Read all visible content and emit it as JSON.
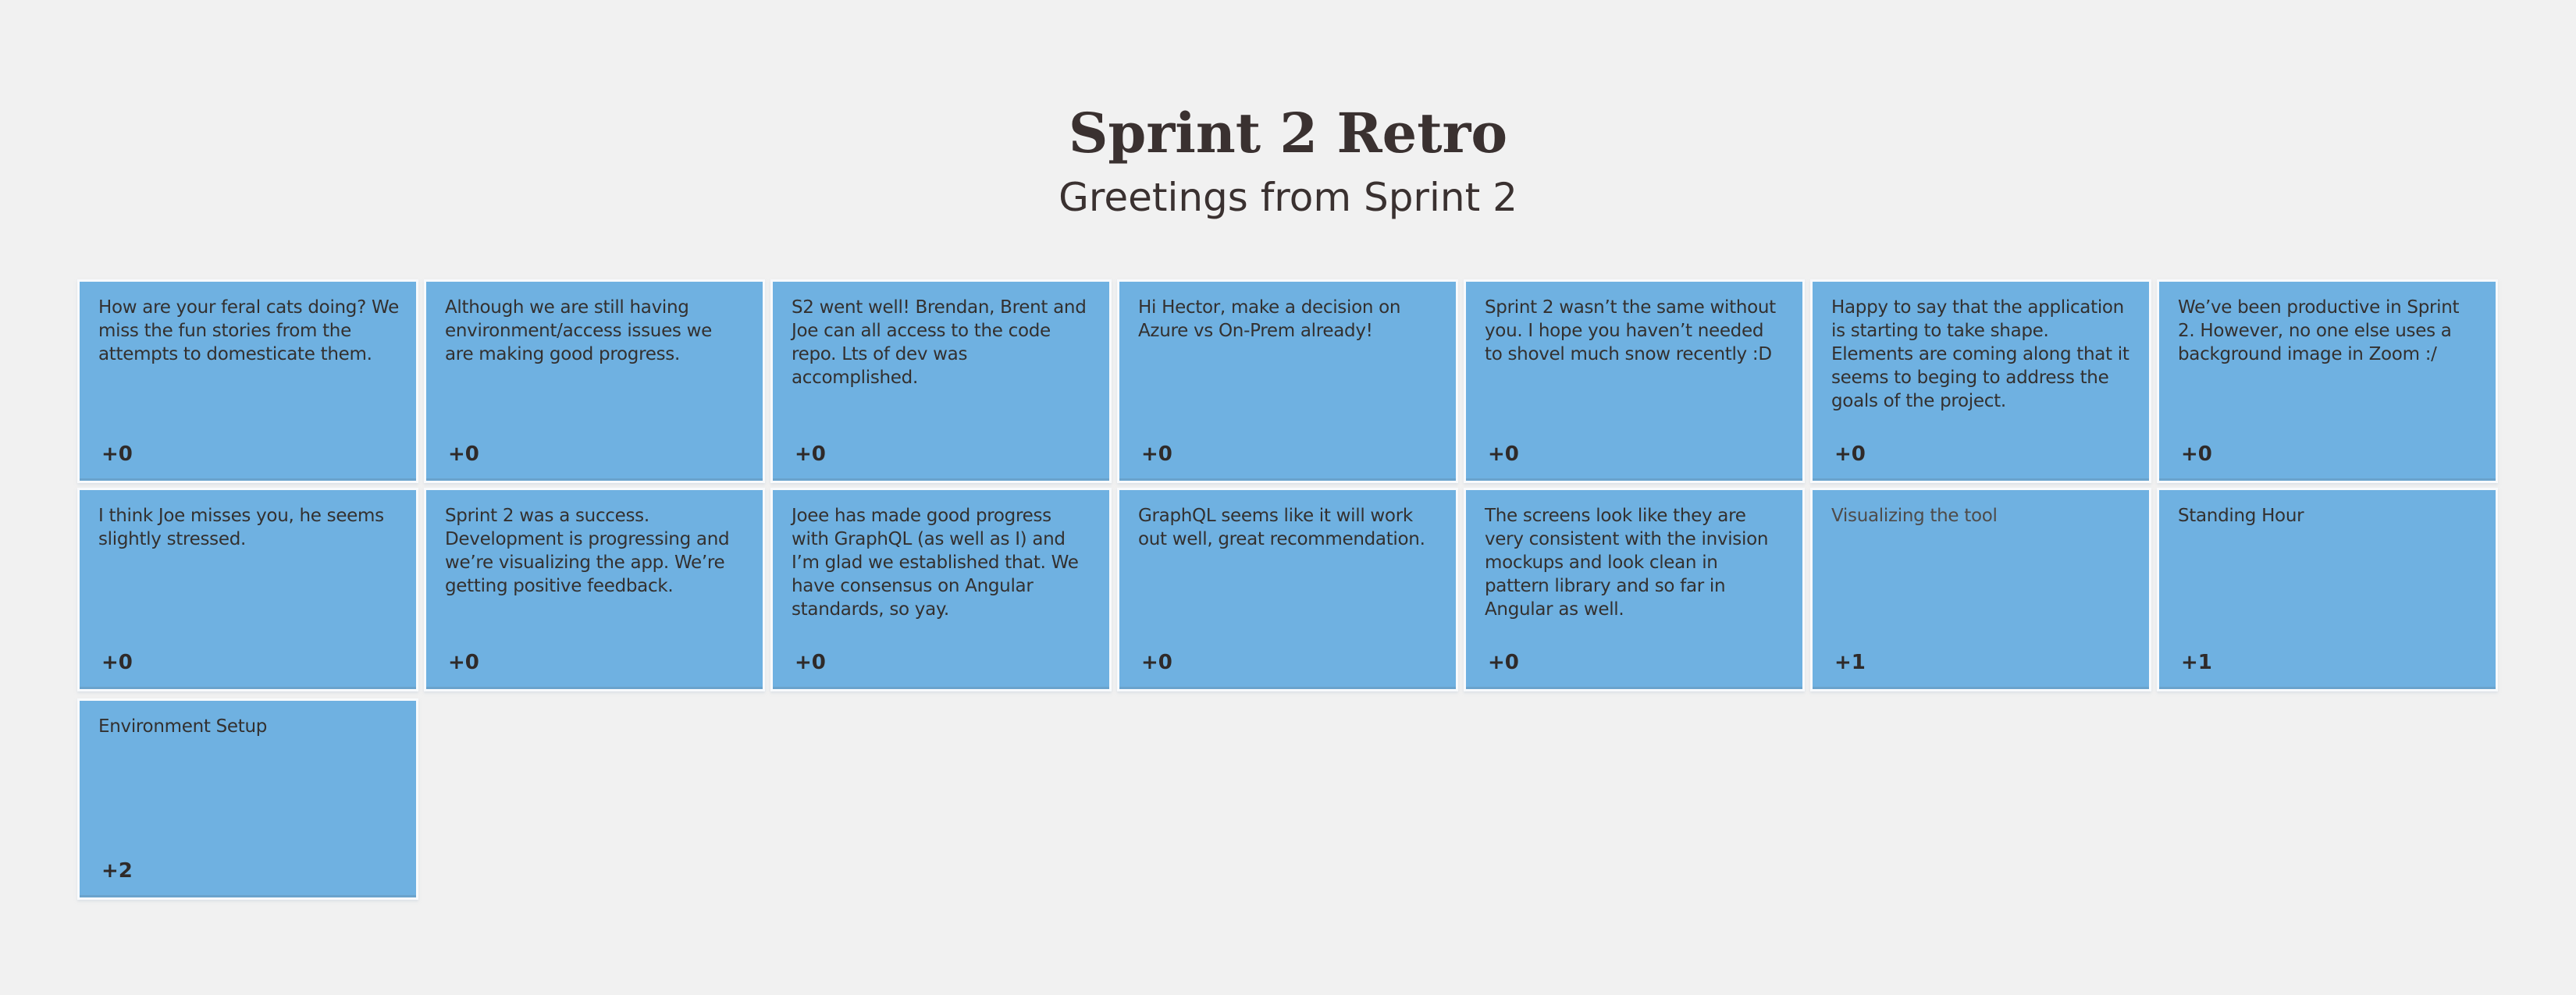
{
  "header": {
    "title": "Sprint 2 Retro",
    "subtitle": "Greetings from Sprint 2"
  },
  "colors": {
    "background": "#f1f1f1",
    "card": "#6fb1e1",
    "text": "#3a3130"
  },
  "cards": [
    {
      "text": "How are your feral cats doing? We miss the fun stories from the attempts to domesticate them.",
      "votes": "+0"
    },
    {
      "text": "Although we are still having environment/access issues we are making good progress.",
      "votes": "+0"
    },
    {
      "text": "S2 went well! Brendan, Brent and Joe can all access to the code repo. Lts of dev was accomplished.",
      "votes": "+0"
    },
    {
      "text": "Hi Hector, make a decision on Azure vs On-Prem already!",
      "votes": "+0"
    },
    {
      "text": "Sprint 2 wasn’t the same without you. I hope you haven’t needed to shovel much snow recently :D",
      "votes": "+0"
    },
    {
      "text": "Happy to say that the application is starting to take shape. Elements are coming along that it seems to beging to address the goals of the project.",
      "votes": "+0"
    },
    {
      "text": "We’ve been productive in Sprint 2. However, no one else uses a background image in Zoom :/",
      "votes": "+0"
    },
    {
      "text": "I think Joe misses you, he seems slightly stressed.",
      "votes": "+0"
    },
    {
      "text": "Sprint 2 was a success. Development is progressing and we’re visualizing the app. We’re getting positive feedback.",
      "votes": "+0"
    },
    {
      "text": "Joee has made good progress with GraphQL (as well as I) and I’m glad we established that. We have consensus on Angular standards, so yay.",
      "votes": "+0"
    },
    {
      "text": "GraphQL seems like it will work out well, great recommendation.",
      "votes": "+0"
    },
    {
      "text": "The screens look like they are very consistent with the invision mockups and look clean in pattern library and so far in Angular as well.",
      "votes": "+0"
    },
    {
      "text": "Visualizing the tool",
      "votes": "+1"
    },
    {
      "text": "Standing Hour",
      "votes": "+1"
    },
    {
      "text": "Environment Setup",
      "votes": "+2"
    }
  ]
}
